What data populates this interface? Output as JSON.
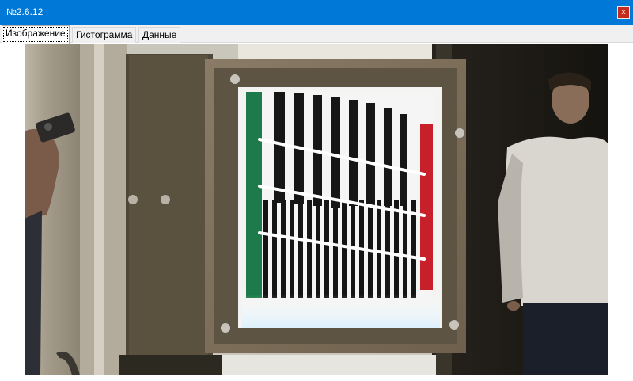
{
  "window": {
    "title": "№2.6.12",
    "close_label": "x"
  },
  "tabs": [
    {
      "label": "Изображение",
      "active": true
    },
    {
      "label": "Гистограмма",
      "active": false
    },
    {
      "label": "Данные",
      "active": false
    }
  ],
  "image": {
    "description_icon": "photo-of-bar-target-on-frame",
    "colors": {
      "titlebar": "#0078d7",
      "close": "#c42b1c",
      "stripe_green": "#1e7a4a",
      "stripe_red": "#c8202a",
      "line_white": "#ffffff"
    }
  }
}
